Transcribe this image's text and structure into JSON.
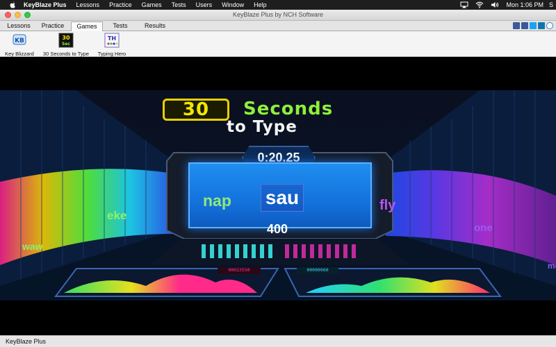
{
  "menubar": {
    "app_name": "KeyBlaze Plus",
    "items": [
      "Lessons",
      "Practice",
      "Games",
      "Tests",
      "Users",
      "Window",
      "Help"
    ],
    "clock": "Mon 1:06 PM",
    "user_initial": "S"
  },
  "window": {
    "title": "KeyBlaze Plus by NCH Software"
  },
  "tabs": [
    {
      "label": "Lessons",
      "active": false
    },
    {
      "label": "Practice",
      "active": false
    },
    {
      "label": "Games",
      "active": true
    },
    {
      "label": "Tests",
      "active": false
    },
    {
      "label": "Results",
      "active": false
    }
  ],
  "toolbar": {
    "items": [
      {
        "label": "Key Blizzard",
        "icon": "key-blizzard-icon"
      },
      {
        "label": "30 Seconds to Type",
        "icon": "thirty-seconds-icon"
      },
      {
        "label": "Typing Hero",
        "icon": "typing-hero-icon"
      }
    ],
    "icon_text": {
      "kb": "KB",
      "thirty_top": "30",
      "thirty_bottom": "Sec",
      "th": "TH"
    }
  },
  "game": {
    "title_number": "30",
    "title_word": "Seconds",
    "subtitle": "to Type",
    "timer": "0:20.25",
    "previous_word": "nap",
    "current_word": "sau",
    "score": "400",
    "floating_words": [
      {
        "text": "waw",
        "color": "#8ff06a"
      },
      {
        "text": "eke",
        "color": "#8ff06a"
      },
      {
        "text": "fly",
        "color": "#b457f2"
      },
      {
        "text": "one",
        "color": "#9d5cf0"
      },
      {
        "text": "me",
        "color": "#8a5cf0"
      }
    ],
    "lcd_left": "00022550",
    "lcd_right": "00000960",
    "colors": {
      "accent_yellow": "#f2e600",
      "accent_green": "#8ef03a",
      "screen_blue": "#1f8ef0"
    }
  },
  "statusbar": {
    "text": "KeyBlaze Plus"
  }
}
